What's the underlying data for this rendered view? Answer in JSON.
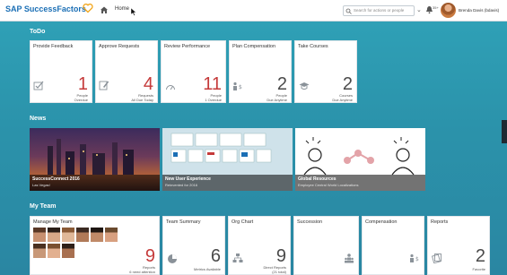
{
  "header": {
    "logo_text": "SAP SuccessFactors",
    "home_label": "Home",
    "search_placeholder": "Search for actions or people",
    "notification_count": "35+",
    "user_name": "Brenda Davis (bdavis)"
  },
  "sections": {
    "todo": "ToDo",
    "news": "News",
    "my_team": "My Team"
  },
  "todo_tiles": [
    {
      "title": "Provide Feedback",
      "value": "1",
      "label1": "People",
      "label2": "Overdue",
      "icon": "feedback-check-icon"
    },
    {
      "title": "Approve Requests",
      "value": "4",
      "label1": "Requests",
      "label2": "All Due Today",
      "icon": "approve-edit-icon"
    },
    {
      "title": "Review Performance",
      "value": "11",
      "label1": "People",
      "label2": "1 Overdue",
      "icon": "gauge-icon"
    },
    {
      "title": "Plan Compensation",
      "value": "2",
      "label1": "People",
      "label2": "Due Anytime",
      "icon": "people-money-icon"
    },
    {
      "title": "Take Courses",
      "value": "2",
      "label1": "Courses",
      "label2": "Due Anytime",
      "icon": "graduation-cap-icon"
    }
  ],
  "news_items": [
    {
      "title": "SuccessConnect 2016",
      "subtitle": "Las Vegas!"
    },
    {
      "title": "New User Experience",
      "subtitle": "Reinvented for 2016"
    },
    {
      "title": "Global Resources",
      "subtitle": "Employee Central World Localizations"
    }
  ],
  "team_tiles": [
    {
      "title": "Manage My Team",
      "value": "9",
      "label1": "Reports",
      "label2": "6 need attention"
    },
    {
      "title": "Team Summary",
      "value": "6",
      "label1": "Metrics Available",
      "label2": ""
    },
    {
      "title": "Org Chart",
      "value": "9",
      "label1": "Direct Reports",
      "label2": "(21 total)"
    },
    {
      "title": "Succession",
      "value": "",
      "label1": "",
      "label2": ""
    },
    {
      "title": "Compensation",
      "value": "",
      "label1": "",
      "label2": ""
    },
    {
      "title": "Reports",
      "value": "2",
      "label1": "Favorite",
      "label2": ""
    }
  ],
  "colors": {
    "brand_blue": "#1b6fb5",
    "background": "#2a8fa8",
    "alert_red": "#c53a3a"
  }
}
